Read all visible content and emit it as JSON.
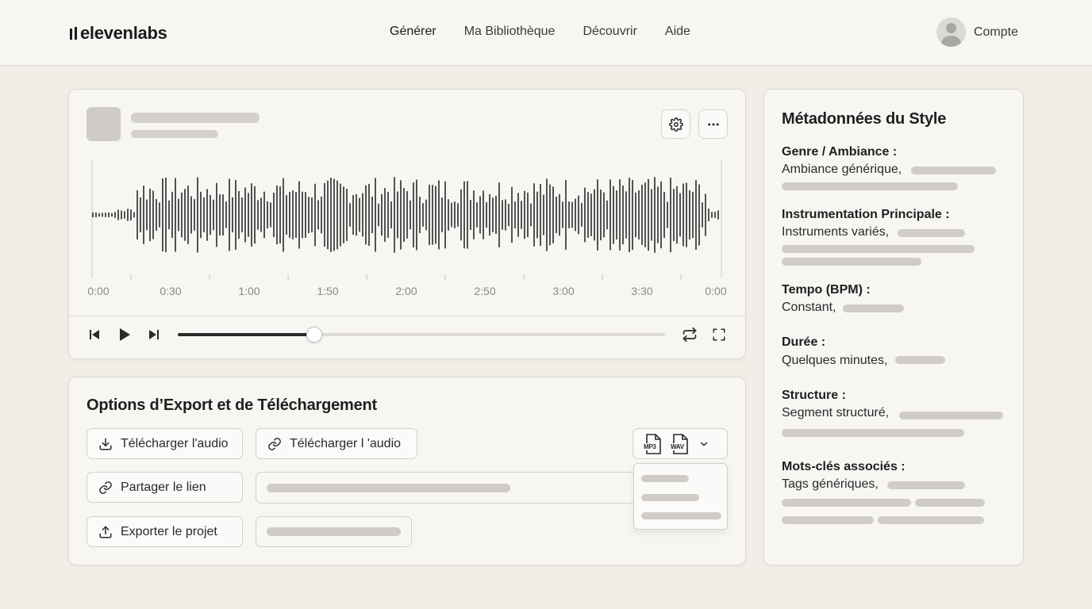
{
  "header": {
    "brand": "elevenlabs",
    "nav": [
      {
        "label": "Générer",
        "active": true
      },
      {
        "label": "Ma Bibliothèque",
        "active": false
      },
      {
        "label": "Découvrir",
        "active": false
      },
      {
        "label": "Aide",
        "active": false
      }
    ],
    "account_label": "Compte"
  },
  "player": {
    "timeline_labels": [
      "0:00",
      "0:30",
      "1:00",
      "1:50",
      "2:00",
      "2:50",
      "3:00",
      "3:30",
      "0:00"
    ],
    "progress_fraction": 0.28,
    "icons": {
      "settings": "gear-icon",
      "more": "more-horizontal-icon",
      "previous": "skip-back-icon",
      "play": "play-icon",
      "next": "skip-forward-icon",
      "repeat": "repeat-icon",
      "fullscreen": "fullscreen-icon"
    }
  },
  "export": {
    "title": "Options d’Export et de Téléchargement",
    "download_audio_1": "Télécharger l'audio",
    "download_audio_2": "Télécharger l 'audio",
    "share_link": "Partager le lien",
    "export_project": "Exporter le projet",
    "formats": [
      "MP3",
      "WAV"
    ]
  },
  "metadata": {
    "title": "Métadonnées du Style",
    "sections": [
      {
        "label": "Genre / Ambiance :",
        "value": "Ambiance générique,"
      },
      {
        "label": "Instrumentation Principale :",
        "value": "Instruments variés,"
      },
      {
        "label": "Tempo (BPM) :",
        "value": "Constant,"
      },
      {
        "label": "Durée :",
        "value": "Quelques minutes,"
      },
      {
        "label": "Structure :",
        "value": "Segment structuré,"
      },
      {
        "label": "Mots-clés associés :",
        "value": "Tags génériques,"
      }
    ]
  },
  "colors": {
    "background": "#f1eee7",
    "card": "#f7f6f3",
    "accent": "#2a2a2a",
    "skeleton": "#d4d1cc"
  }
}
